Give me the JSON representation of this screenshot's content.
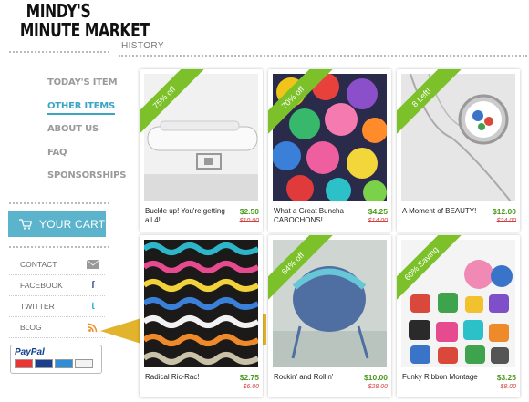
{
  "brand": {
    "line1": "MINDY'S",
    "line2": "MINUTE MARKET"
  },
  "nav": [
    {
      "label": "TODAY'S ITEM",
      "active": false
    },
    {
      "label": "OTHER ITEMS",
      "active": true
    },
    {
      "label": "ABOUT US",
      "active": false
    },
    {
      "label": "FAQ",
      "active": false
    },
    {
      "label": "SPONSORSHIPS",
      "active": false
    }
  ],
  "cart": {
    "label": "YOUR CART"
  },
  "links": [
    {
      "label": "CONTACT",
      "icon": "mail-icon"
    },
    {
      "label": "FACEBOOK",
      "icon": "facebook-icon"
    },
    {
      "label": "TWITTER",
      "icon": "twitter-icon"
    },
    {
      "label": "BLOG",
      "icon": "rss-icon"
    }
  ],
  "payment": {
    "name": "PayPal",
    "cards": [
      "MasterCard",
      "VISA",
      "AMEX",
      "DISCOVER"
    ]
  },
  "section": {
    "title": "HISTORY"
  },
  "colors": {
    "accent": "#5bb4cb",
    "ribbon": "#7cc02a",
    "price": "#4a9a20",
    "old_price": "#d04040",
    "arrow": "#e2b32c"
  },
  "products": [
    {
      "badge": "75% off",
      "title": "Buckle up! You're getting all 4!",
      "price": "$2.50",
      "old_price": "$10.00",
      "image": "white-leather-bracelet"
    },
    {
      "badge": "70% off",
      "title": "What a Great Buncha CABOCHONS!",
      "price": "$4.25",
      "old_price": "$14.00",
      "image": "colorful-resin-flowers"
    },
    {
      "badge": "8 Left!",
      "title": "A Moment of BEAUTY!",
      "price": "$12.00",
      "old_price": "$24.00",
      "image": "pocket-watch-necklace"
    },
    {
      "badge": "",
      "title": "Radical Ric-Rac!",
      "price": "$2.75",
      "old_price": "$6.00",
      "image": "ric-rac-trim"
    },
    {
      "badge": "64% off",
      "title": "Rockin' and Rollin'",
      "price": "$10.00",
      "old_price": "$28.00",
      "image": "knit-baby-hat"
    },
    {
      "badge": "60% Saving",
      "title": "Funky Ribbon Montage",
      "price": "$3.25",
      "old_price": "$8.00",
      "image": "ribbon-spools"
    }
  ]
}
